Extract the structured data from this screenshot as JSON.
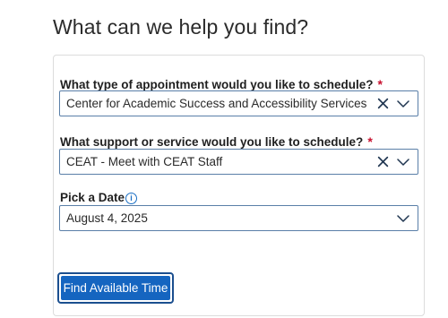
{
  "page": {
    "title": "What can we help you find?"
  },
  "form": {
    "appointment_type": {
      "label": "What type of appointment would you like to schedule?",
      "required_mark": "*",
      "value": "Center for Academic Success and Accessibility Services"
    },
    "support_service": {
      "label": "What support or service would you like to schedule?",
      "required_mark": "*",
      "value": "CEAT - Meet with CEAT Staff"
    },
    "date": {
      "label": "Pick a Date",
      "info_glyph": "i",
      "value": "August 4, 2025"
    },
    "submit_label": "Find Available Time"
  },
  "colors": {
    "primary_button": "#1565c0",
    "required": "#c8102e",
    "field_border": "#5a7fa8"
  },
  "icons": [
    "clear-icon",
    "chevron-down-icon",
    "info-icon"
  ]
}
